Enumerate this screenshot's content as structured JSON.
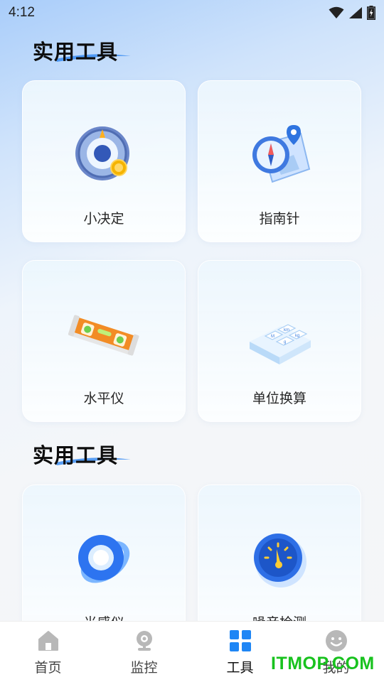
{
  "status": {
    "time": "4:12"
  },
  "sections": [
    {
      "title": "实用工具"
    },
    {
      "title": "实用工具"
    }
  ],
  "cards": [
    {
      "label": "小决定",
      "icon": "decision-wheel-icon"
    },
    {
      "label": "指南针",
      "icon": "compass-icon"
    },
    {
      "label": "水平仪",
      "icon": "level-icon"
    },
    {
      "label": "单位换算",
      "icon": "unit-conversion-icon"
    },
    {
      "label": "光感仪",
      "icon": "light-meter-icon"
    },
    {
      "label": "噪音检测",
      "icon": "noise-meter-icon"
    }
  ],
  "tabs": [
    {
      "label": "首页",
      "icon": "home-icon"
    },
    {
      "label": "监控",
      "icon": "camera-icon"
    },
    {
      "label": "工具",
      "icon": "grid-icon",
      "active": true
    },
    {
      "label": "我的",
      "icon": "smiley-icon"
    }
  ],
  "watermark": "ITMOP.COM",
  "colors": {
    "accent": "#1f86f5",
    "tab_inactive": "#b8b8b8",
    "watermark": "#18c21e"
  }
}
